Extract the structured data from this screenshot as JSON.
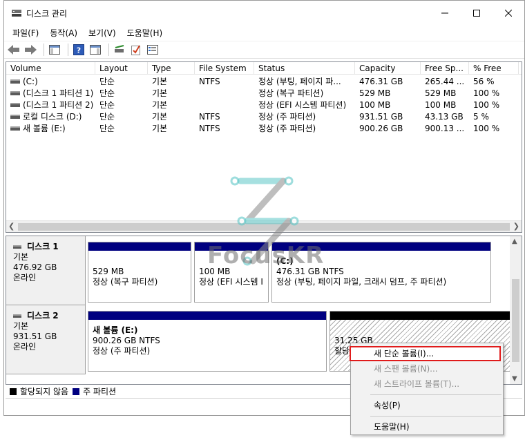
{
  "window": {
    "title": "디스크 관리",
    "min": "—",
    "max": "☐",
    "close": "✕"
  },
  "menu": [
    "파일(F)",
    "동작(A)",
    "보기(V)",
    "도움말(H)"
  ],
  "volume_table": {
    "columns": [
      "Volume",
      "Layout",
      "Type",
      "File System",
      "Status",
      "Capacity",
      "Free Sp...",
      "% Free"
    ],
    "rows": [
      [
        "(C:)",
        "단순",
        "기본",
        "NTFS",
        "정상 (부팅, 페이지 파...",
        "476.31 GB",
        "265.44 ...",
        "56 %"
      ],
      [
        "(디스크 1 파티션 1)",
        "단순",
        "기본",
        "",
        "정상 (복구 파티션)",
        "529 MB",
        "529 MB",
        "100 %"
      ],
      [
        "(디스크 1 파티션 2)",
        "단순",
        "기본",
        "",
        "정상 (EFI 시스템 파티션)",
        "100 MB",
        "100 MB",
        "100 %"
      ],
      [
        "로컬 디스크 (D:)",
        "단순",
        "기본",
        "NTFS",
        "정상 (주 파티션)",
        "931.51 GB",
        "43.13 GB",
        "5 %"
      ],
      [
        "새 볼륨 (E:)",
        "단순",
        "기본",
        "NTFS",
        "정상 (주 파티션)",
        "900.26 GB",
        "900.13 ...",
        "100 %"
      ]
    ]
  },
  "disks": [
    {
      "name": "디스크 1",
      "type": "기본",
      "size": "476.92 GB",
      "status": "온라인",
      "partitions": [
        {
          "line1": "",
          "line2": "529 MB",
          "line3": "정상 (복구 파티션)"
        },
        {
          "line1": "",
          "line2": "100 MB",
          "line3": "정상 (EFI 시스템 I"
        },
        {
          "line1": "(C:)",
          "line2": "476.31 GB NTFS",
          "line3": "정상 (부팅, 페이지 파일, 크래시 덤프, 주 파티션)"
        }
      ]
    },
    {
      "name": "디스크 2",
      "type": "기본",
      "size": "931.51 GB",
      "status": "온라인",
      "partitions": [
        {
          "line1": "새 볼륨  (E:)",
          "line2": "900.26 GB NTFS",
          "line3": "정상 (주 파티션)"
        },
        {
          "line1": "",
          "line2": "31.25 GB",
          "line3": "할당"
        }
      ]
    }
  ],
  "legend": [
    {
      "label": "할당되지 않음",
      "color": "#000000"
    },
    {
      "label": "주 파티션",
      "color": "#000080"
    }
  ],
  "context_menu": {
    "items": [
      {
        "label": "새 단순 볼륨(I)...",
        "enabled": true
      },
      {
        "label": "새 스팬 볼륨(N)...",
        "enabled": false
      },
      {
        "label": "새 스트라이프 볼륨(T)...",
        "enabled": false
      },
      {
        "label": "속성(P)",
        "enabled": true
      },
      {
        "label": "도움말(H)",
        "enabled": true
      }
    ]
  },
  "watermark": {
    "text": "FocusKR"
  },
  "colors": {
    "primary_partition": "#000080",
    "unallocated": "#000000",
    "highlight_border": "#e01b1b"
  }
}
